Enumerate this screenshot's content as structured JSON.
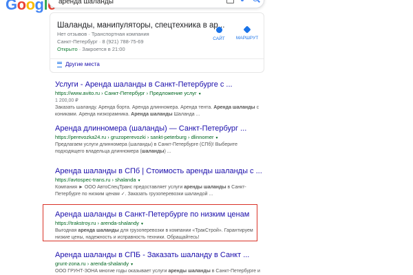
{
  "header": {
    "logo": [
      "G",
      "o",
      "o",
      "g",
      "l",
      "e"
    ],
    "query": "аренда шаланды"
  },
  "local_card": {
    "title": "Шаланды, манипуляторы, спецтехника в ар...",
    "reviews_and_type": "Нет отзывов · Транспортная компания",
    "address_phone": "Санкт-Петербург · 8 (921) 788-75-69",
    "open": "Открыто",
    "closes": " · Закроется в 21:00",
    "website_label": "САЙТ",
    "route_label": "МАРШРУТ",
    "more_places": "Другие места"
  },
  "results": [
    {
      "title": "Услуги - Аренда шаланды в Санкт-Петербурге с ...",
      "url": "https://www.avito.ru › Санкт-Петербург › Предложение услуг",
      "price": "1 200,00 ₽",
      "snippet": [
        [
          "Заказать шаланду. Аренда борта. Аренда длинномера. Аренда тента. ",
          "Аренда шаланды",
          " с"
        ],
        [
          "кониками. Аренда низкорамника. ",
          "Аренда шаланды",
          " Шаланда ..."
        ]
      ]
    },
    {
      "title": "Аренда длинномера (шаланды) — Санкт-Петербург ...",
      "url": "https://perevozka24.ru › gruzoperevozki › sankt-peterburg › dlinnomer",
      "snippet": [
        [
          "Предлагаем услуги длинномера (шаланды) в Санкт-Петербурге (СПб)! Выберите",
          "",
          ""
        ],
        [
          "подходящего владельца длинномера (",
          "шаланды",
          ") ..."
        ]
      ]
    },
    {
      "title": "Аренда шаланды в СПб | Стоимость аренды шаланды с ...",
      "url": "https://avtospec-trans.ru › shalanda",
      "snippet": [
        [
          "Компания ► ООО АвтоСпецТранс предоставляет услуги ",
          "аренды шаланды",
          " в Санкт-"
        ],
        [
          "Петербурге по низким ценам ✓. Заказать грузоперевозки шаландой ...",
          "",
          ""
        ]
      ]
    },
    {
      "title": "Аренда шаланды в Санкт-Петербурге по низким ценам",
      "url": "https://trakstroy.ru › arenda-shalandy",
      "snippet": [
        [
          "Выгодная ",
          "аренда шаланды",
          " для грузоперевозки в компании «ТракСтрой». Гарантируем"
        ],
        [
          "низкие цены, надежность и исправность техники. Обращайтесь!",
          "",
          ""
        ]
      ]
    },
    {
      "title": "Аренда шаланды в СПБ - Заказать шаланду в Санкт ...",
      "url": "grunt-zona.ru › arenda-shalandy",
      "snippet": [
        [
          "ООО ГРУНТ-ЗОНА многие годы оказывает услуги ",
          "аренды шаланды",
          " в Санкт-Петербурге и"
        ]
      ]
    }
  ]
}
